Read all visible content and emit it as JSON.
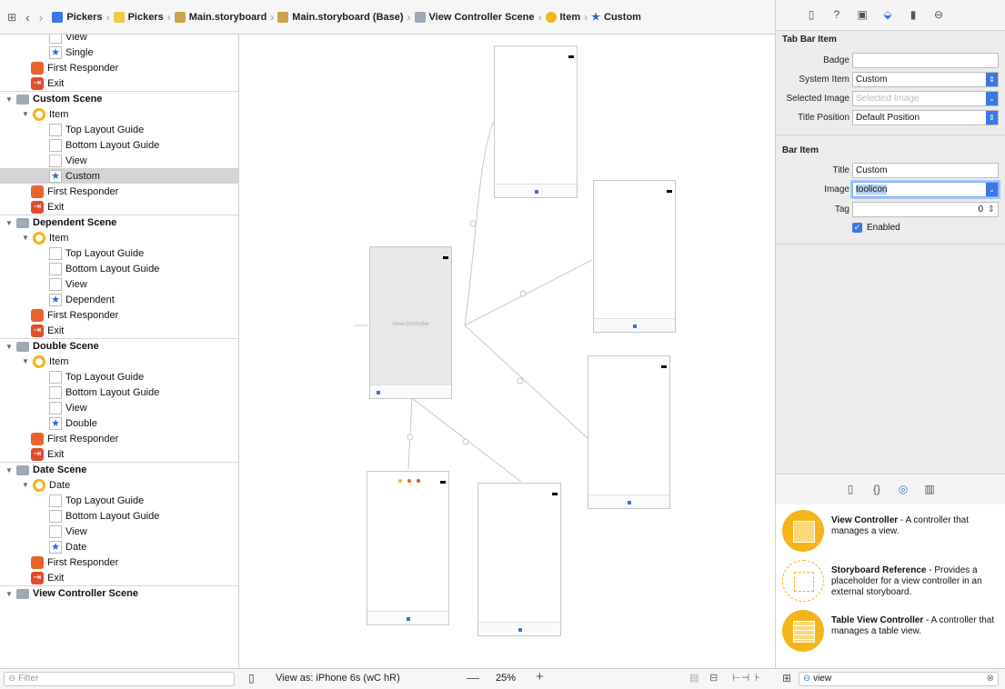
{
  "breadcrumb": [
    "Pickers",
    "Pickers",
    "Main.storyboard",
    "Main.storyboard (Base)",
    "View Controller Scene",
    "Item",
    "Custom"
  ],
  "outline": {
    "rows": [
      {
        "label": "View",
        "kind": "view",
        "level": 3
      },
      {
        "label": "Single",
        "kind": "star",
        "level": 3
      },
      {
        "label": "First Responder",
        "kind": "responder",
        "level": 2
      },
      {
        "label": "Exit",
        "kind": "exit",
        "level": 2
      },
      {
        "label": "Custom Scene",
        "kind": "scene",
        "level": 0
      },
      {
        "label": "Item",
        "kind": "item",
        "level": 1
      },
      {
        "label": "Top Layout Guide",
        "kind": "view",
        "level": 3
      },
      {
        "label": "Bottom Layout Guide",
        "kind": "view",
        "level": 3
      },
      {
        "label": "View",
        "kind": "view",
        "level": 3
      },
      {
        "label": "Custom",
        "kind": "star",
        "level": 3,
        "selected": true
      },
      {
        "label": "First Responder",
        "kind": "responder",
        "level": 2
      },
      {
        "label": "Exit",
        "kind": "exit",
        "level": 2
      },
      {
        "label": "Dependent Scene",
        "kind": "scene",
        "level": 0
      },
      {
        "label": "Item",
        "kind": "item",
        "level": 1
      },
      {
        "label": "Top Layout Guide",
        "kind": "view",
        "level": 3
      },
      {
        "label": "Bottom Layout Guide",
        "kind": "view",
        "level": 3
      },
      {
        "label": "View",
        "kind": "view",
        "level": 3
      },
      {
        "label": "Dependent",
        "kind": "star",
        "level": 3
      },
      {
        "label": "First Responder",
        "kind": "responder",
        "level": 2
      },
      {
        "label": "Exit",
        "kind": "exit",
        "level": 2
      },
      {
        "label": "Double Scene",
        "kind": "scene",
        "level": 0
      },
      {
        "label": "Item",
        "kind": "item",
        "level": 1
      },
      {
        "label": "Top Layout Guide",
        "kind": "view",
        "level": 3
      },
      {
        "label": "Bottom Layout Guide",
        "kind": "view",
        "level": 3
      },
      {
        "label": "View",
        "kind": "view",
        "level": 3
      },
      {
        "label": "Double",
        "kind": "star",
        "level": 3
      },
      {
        "label": "First Responder",
        "kind": "responder",
        "level": 2
      },
      {
        "label": "Exit",
        "kind": "exit",
        "level": 2
      },
      {
        "label": "Date Scene",
        "kind": "scene",
        "level": 0
      },
      {
        "label": "Date",
        "kind": "item",
        "level": 1
      },
      {
        "label": "Top Layout Guide",
        "kind": "view",
        "level": 3
      },
      {
        "label": "Bottom Layout Guide",
        "kind": "view",
        "level": 3
      },
      {
        "label": "View",
        "kind": "view",
        "level": 3
      },
      {
        "label": "Date",
        "kind": "star",
        "level": 3
      },
      {
        "label": "First Responder",
        "kind": "responder",
        "level": 2
      },
      {
        "label": "Exit",
        "kind": "exit",
        "level": 2
      },
      {
        "label": "View Controller Scene",
        "kind": "scene",
        "level": 0
      }
    ],
    "filter_placeholder": "Filter"
  },
  "canvas": {
    "view_controller_label": "View Controller",
    "view_as": "View as: iPhone 6s (wC hR)",
    "zoom": "25%"
  },
  "inspector": {
    "tab_bar_item": {
      "section": "Tab Bar Item",
      "badge_label": "Badge",
      "badge_value": "",
      "system_item_label": "System Item",
      "system_item_value": "Custom",
      "selected_image_label": "Selected Image",
      "selected_image_placeholder": "Selected Image",
      "title_position_label": "Title Position",
      "title_position_value": "Default Position"
    },
    "bar_item": {
      "section": "Bar Item",
      "title_label": "Title",
      "title_value": "Custom",
      "image_label": "Image",
      "image_value": "toolicon",
      "tag_label": "Tag",
      "tag_value": "0",
      "enabled_label": "Enabled",
      "enabled": true
    }
  },
  "library": {
    "items": [
      {
        "title": "View Controller",
        "desc": " - A controller that manages a view."
      },
      {
        "title": "Storyboard Reference",
        "desc": " - Provides a placeholder for a view controller in an external storyboard."
      },
      {
        "title": "Table View Controller",
        "desc": " - A controller that manages a table view."
      }
    ],
    "search_value": "view"
  },
  "colors": {
    "accent": "#3a78e6",
    "yellow": "#f5b41a",
    "star": "#2f6bd6"
  }
}
